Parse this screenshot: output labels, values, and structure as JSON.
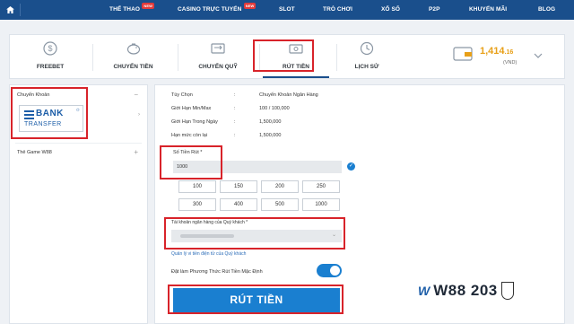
{
  "topnav": {
    "items": [
      {
        "label": "THỂ THAO",
        "badge": "NEW"
      },
      {
        "label": "CASINO TRỰC TUYẾN",
        "badge": "NEW"
      },
      {
        "label": "SLOT"
      },
      {
        "label": "TRÒ CHƠI"
      },
      {
        "label": "XỔ SỐ"
      },
      {
        "label": "P2P"
      },
      {
        "label": "KHUYẾN MÃI"
      },
      {
        "label": "BLOG"
      }
    ]
  },
  "tabs": [
    {
      "label": "FREEBET",
      "icon": "dollar-coin-icon"
    },
    {
      "label": "CHUYỂN TIỀN",
      "icon": "piggy-bank-icon"
    },
    {
      "label": "CHUYỂN QUỸ",
      "icon": "transfer-funds-icon"
    },
    {
      "label": "RÚT TIỀN",
      "icon": "withdraw-cash-icon",
      "active": true
    },
    {
      "label": "LỊCH SỬ",
      "icon": "history-clock-icon"
    }
  ],
  "balance": {
    "amount": "1,414",
    "decimals": ".16",
    "currency": "(VND)"
  },
  "left": {
    "method_header": "Chuyển Khoản",
    "bank_logo": {
      "line1": "BANK",
      "line2": "TRANSFER"
    },
    "game_header": "Thẻ Game W88"
  },
  "info": [
    {
      "label": "Tùy Chọn",
      "value": "Chuyển Khoản Ngân Hàng"
    },
    {
      "label": "Giới Hạn Min/Max",
      "value": "100 / 100,000"
    },
    {
      "label": "Giới Hạn Trong Ngày",
      "value": "1,500,000"
    },
    {
      "label": "Hạn mức còn lại",
      "value": "1,500,000"
    }
  ],
  "withdraw": {
    "amount_label": "Số Tiền Rút *",
    "amount_value": "1000",
    "quick_amounts": [
      "100",
      "150",
      "200",
      "250",
      "300",
      "400",
      "500",
      "1000"
    ],
    "account_label": "Tài khoản ngân hàng của Quý khách *",
    "manage_link": "Quản lý vi tiền điện tử của Quý khách",
    "default_label": "Đặt làm Phương Thức Rút Tiền Mặc Định",
    "submit_label": "RÚT TIỀN"
  },
  "watermark": "W88 203",
  "colors": {
    "nav": "#1a4f8c",
    "accent": "#1a7fd0",
    "highlight": "#d8232a",
    "balance": "#e8a018"
  }
}
